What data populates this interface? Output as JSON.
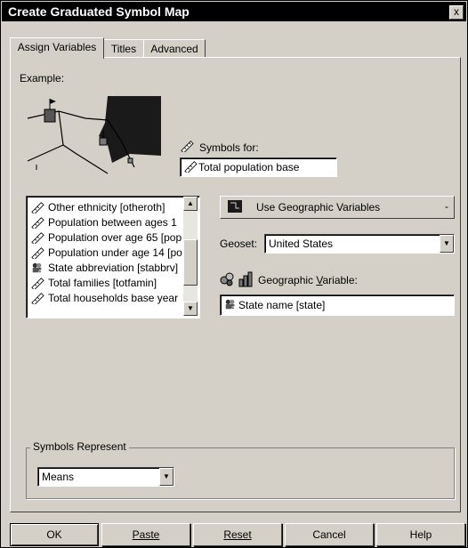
{
  "window": {
    "title": "Create Graduated Symbol Map",
    "close_glyph": "x"
  },
  "tabs": [
    {
      "label": "Assign Variables"
    },
    {
      "label": "Titles"
    },
    {
      "label": "Advanced"
    }
  ],
  "example": {
    "label": "Example:"
  },
  "symbols_for": {
    "label": "Symbols for:",
    "value": "Total population base"
  },
  "variable_list": {
    "items": [
      {
        "label": "Other ethnicity [otheroth]",
        "icon": "ruler-icon"
      },
      {
        "label": "Population between ages 1",
        "icon": "ruler-icon"
      },
      {
        "label": "Population over age 65 [pop",
        "icon": "ruler-icon"
      },
      {
        "label": "Population under age 14 [po",
        "icon": "ruler-icon"
      },
      {
        "label": "State abbreviation [stabbrv]",
        "icon": "people-string-icon"
      },
      {
        "label": "Total families [totfamin]",
        "icon": "ruler-icon"
      },
      {
        "label": "Total households base year",
        "icon": "ruler-icon"
      }
    ]
  },
  "geo_variables_button": {
    "label": "Use Geographic Variables",
    "arrow": "-"
  },
  "geoset": {
    "label": "Geoset:",
    "value": "United States"
  },
  "geographic_variable": {
    "label_prefix": "Geographic ",
    "label_mnemonic": "V",
    "label_suffix": "ariable:",
    "value": "State name [state]"
  },
  "symbols_represent": {
    "label": "Symbols Represent",
    "value": "Means"
  },
  "buttons": {
    "ok": "OK",
    "paste": "Paste",
    "reset": "Reset",
    "cancel": "Cancel",
    "help": "Help"
  },
  "colors": {
    "title_bg": "#000000",
    "face": "#d4d0c8",
    "field": "#ffffff",
    "map_dark": "#1a1a1a"
  }
}
